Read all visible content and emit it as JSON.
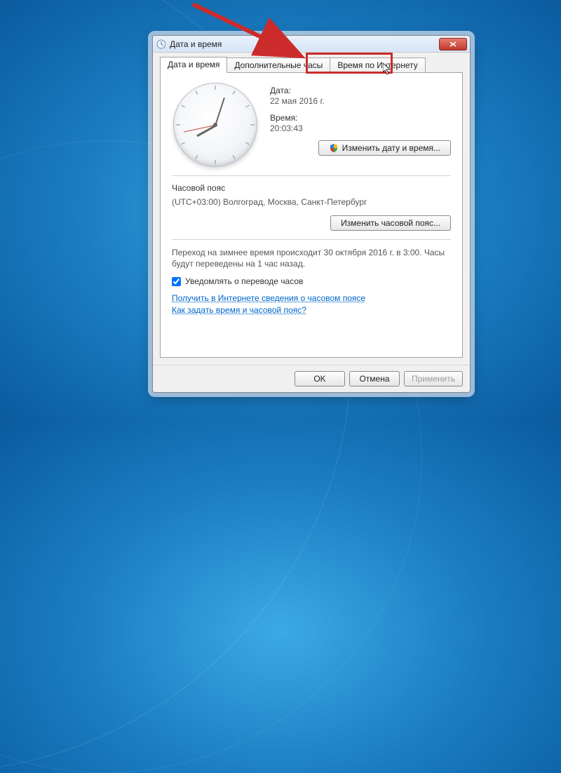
{
  "window": {
    "title": "Дата и время"
  },
  "tabs": {
    "date_time": "Дата и время",
    "additional_clocks": "Дополнительные часы",
    "internet_time": "Время по Интернету"
  },
  "date_section": {
    "label": "Дата:",
    "value": "22 мая 2016 г."
  },
  "time_section": {
    "label": "Время:",
    "value": "20:03:43"
  },
  "buttons": {
    "change_date_time": "Изменить дату и время...",
    "change_timezone": "Изменить часовой пояс...",
    "ok": "OK",
    "cancel": "Отмена",
    "apply": "Применить"
  },
  "timezone": {
    "label": "Часовой пояс",
    "value": "(UTC+03:00) Волгоград, Москва, Санкт-Петербург"
  },
  "dst": {
    "text": "Переход на зимнее время происходит 30 октября 2016 г. в 3:00. Часы будут переведены на 1 час назад.",
    "checkbox_label": "Уведомлять о переводе часов",
    "checked": true
  },
  "links": {
    "tz_info": "Получить в Интернете сведения о часовом поясе",
    "howto": "Как задать время и часовой пояс?"
  }
}
